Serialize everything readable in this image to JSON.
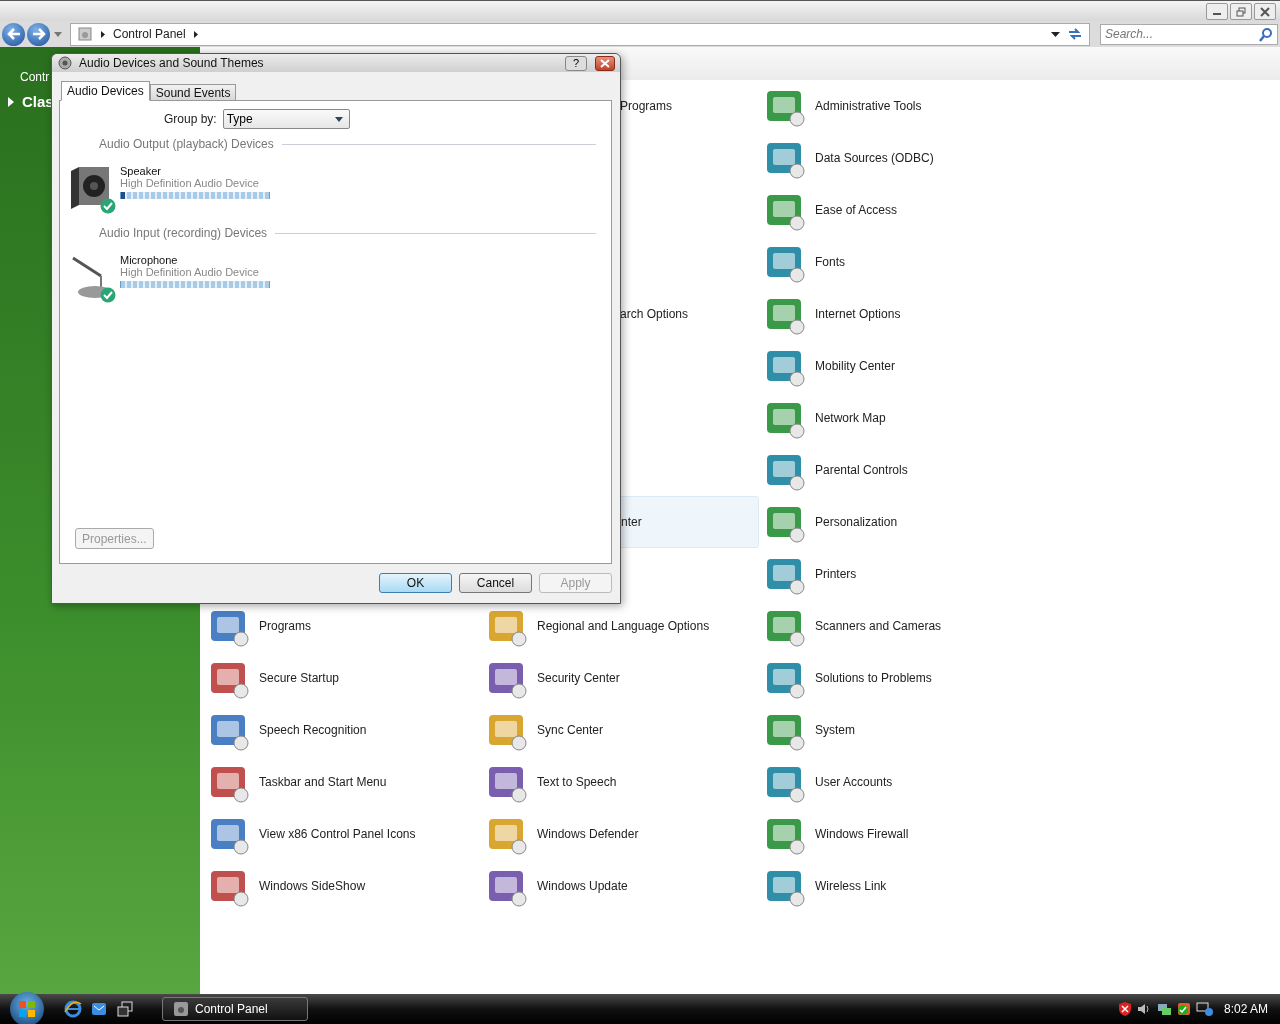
{
  "address_bar": {
    "path": [
      "Control Panel"
    ]
  },
  "search": {
    "placeholder": "Search..."
  },
  "sidebar": {
    "items": [
      {
        "label": "Contr",
        "kind": "link"
      },
      {
        "label": "Clas",
        "kind": "heading"
      }
    ]
  },
  "applets": {
    "rows": [
      {
        "cells": [
          null,
          {
            "label": "Programs",
            "covered": true,
            "hovered": false
          },
          {
            "label": "Administrative Tools",
            "covered": false,
            "hovered": false
          }
        ]
      },
      {
        "cells": [
          null,
          null,
          {
            "label": "Data Sources (ODBC)",
            "covered": false,
            "hovered": false
          }
        ]
      },
      {
        "cells": [
          null,
          null,
          {
            "label": "Ease of Access",
            "covered": false,
            "hovered": false
          }
        ]
      },
      {
        "cells": [
          null,
          null,
          {
            "label": "Fonts",
            "covered": false,
            "hovered": false
          }
        ]
      },
      {
        "cells": [
          null,
          {
            "label": "arch Options",
            "covered": true,
            "hovered": false
          },
          {
            "label": "Internet Options",
            "covered": false,
            "hovered": false
          }
        ]
      },
      {
        "cells": [
          null,
          null,
          {
            "label": "Mobility Center",
            "covered": false,
            "hovered": false
          }
        ]
      },
      {
        "cells": [
          null,
          null,
          {
            "label": "Network Map",
            "covered": false,
            "hovered": false
          }
        ]
      },
      {
        "cells": [
          null,
          null,
          {
            "label": "Parental Controls",
            "covered": false,
            "hovered": false
          }
        ]
      },
      {
        "cells": [
          null,
          {
            "label": "nter",
            "covered": true,
            "hovered": true
          },
          {
            "label": "Personalization",
            "covered": false,
            "hovered": false
          }
        ]
      },
      {
        "cells": [
          null,
          null,
          {
            "label": "Printers",
            "covered": false,
            "hovered": false
          }
        ]
      },
      {
        "cells": [
          {
            "label": "Programs",
            "covered": false,
            "hovered": false
          },
          {
            "label": "Regional and Language Options",
            "covered": false,
            "hovered": false
          },
          {
            "label": "Scanners and Cameras",
            "covered": false,
            "hovered": false
          }
        ]
      },
      {
        "cells": [
          {
            "label": "Secure Startup",
            "covered": false,
            "hovered": false
          },
          {
            "label": "Security Center",
            "covered": false,
            "hovered": false
          },
          {
            "label": "Solutions to Problems",
            "covered": false,
            "hovered": false
          }
        ]
      },
      {
        "cells": [
          {
            "label": "Speech Recognition",
            "covered": false,
            "hovered": false
          },
          {
            "label": "Sync Center",
            "covered": false,
            "hovered": false
          },
          {
            "label": "System",
            "covered": false,
            "hovered": false
          }
        ]
      },
      {
        "cells": [
          {
            "label": "Taskbar and Start Menu",
            "covered": false,
            "hovered": false
          },
          {
            "label": "Text to Speech",
            "covered": false,
            "hovered": false
          },
          {
            "label": "User Accounts",
            "covered": false,
            "hovered": false
          }
        ]
      },
      {
        "cells": [
          {
            "label": "View x86 Control Panel Icons",
            "covered": false,
            "hovered": false
          },
          {
            "label": "Windows Defender",
            "covered": false,
            "hovered": false
          },
          {
            "label": "Windows Firewall",
            "covered": false,
            "hovered": false
          }
        ]
      },
      {
        "cells": [
          {
            "label": "Windows SideShow",
            "covered": false,
            "hovered": false
          },
          {
            "label": "Windows Update",
            "covered": false,
            "hovered": false
          },
          {
            "label": "Wireless Link",
            "covered": false,
            "hovered": false
          }
        ]
      }
    ]
  },
  "dialog": {
    "title": "Audio Devices and Sound Themes",
    "help_button": "?",
    "tabs": [
      {
        "label": "Audio Devices",
        "selected": true
      },
      {
        "label": "Sound Events",
        "selected": false
      }
    ],
    "group_by": {
      "label": "Group by:",
      "value": "Type"
    },
    "sections": [
      {
        "heading": "Audio Output (playback) Devices",
        "devices": [
          {
            "name": "Speaker",
            "description": "High Definition Audio Device",
            "kind": "speaker",
            "level": 0.03,
            "default": true
          }
        ]
      },
      {
        "heading": "Audio Input (recording) Devices",
        "devices": [
          {
            "name": "Microphone",
            "description": "High Definition Audio Device",
            "kind": "microphone",
            "level": 0,
            "default": true
          }
        ]
      }
    ],
    "properties_button": {
      "label": "Properties...",
      "disabled": true
    },
    "buttons": [
      {
        "label": "OK",
        "default": true,
        "disabled": false
      },
      {
        "label": "Cancel",
        "default": false,
        "disabled": false
      },
      {
        "label": "Apply",
        "default": false,
        "disabled": true
      }
    ]
  },
  "taskbar": {
    "tasks": [
      {
        "label": "Control Panel",
        "selected": true
      }
    ],
    "clock": "8:02 AM"
  }
}
